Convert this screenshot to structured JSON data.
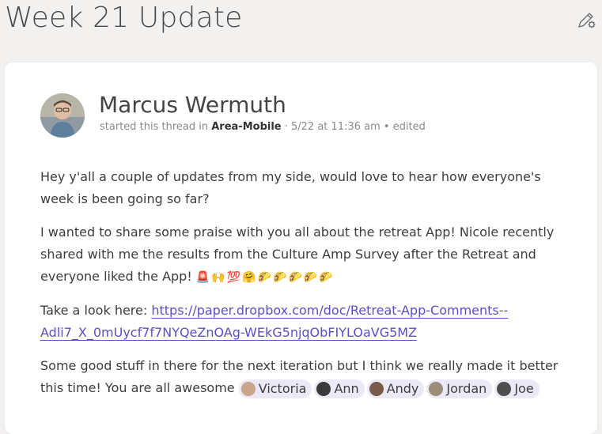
{
  "header": {
    "title": "Week 21 Update",
    "settings_icon": "edit-settings-icon"
  },
  "post": {
    "author": "Marcus Wermuth",
    "meta_prefix": "started this thread in",
    "channel": "Area-Mobile",
    "meta_suffix": "· 5/22 at 11:36 am • edited",
    "paragraph1": "Hey y'all a couple of updates from my side, would love to hear how everyone's week is been going so far?",
    "paragraph2": "I wanted to share some praise with you all about the retreat App! Nicole recently shared with me the results from the Culture Amp Survey after the Retreat and everyone liked the App!",
    "emojis": [
      "🚨",
      "🙌",
      "💯",
      "🤗",
      "🌮",
      "🌮",
      "🌮",
      "🌮",
      "🌮"
    ],
    "link_prefix": "Take a look here:",
    "link_url": "https://paper.dropbox.com/doc/Retreat-App-Comments--Adli7_X_0mUycf7f7NYQeZnOAg-WEkG5njqObFIYLOaVG5MZ",
    "paragraph4": "Some good stuff in there for the next iteration but I think we really made it better this time! You are all awesome",
    "mentions": [
      {
        "name": "Victoria",
        "color": "#c9a58a"
      },
      {
        "name": "Ann",
        "color": "#3a3a3a"
      },
      {
        "name": "Andy",
        "color": "#7a5a48"
      },
      {
        "name": "Jordan",
        "color": "#9c8c7a"
      },
      {
        "name": "Joe",
        "color": "#4e4e4e"
      }
    ]
  },
  "colors": {
    "background": "#f3f1f0",
    "card": "#ffffff",
    "link": "#5b4fc9",
    "mention_bg": "#ece9f7"
  }
}
